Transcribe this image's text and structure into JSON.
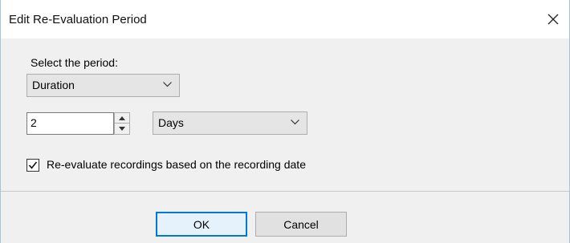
{
  "dialog": {
    "title": "Edit Re-Evaluation Period",
    "close_icon": "close-icon"
  },
  "form": {
    "period_label": "Select the period:",
    "period_value": "Duration",
    "amount_value": "2",
    "unit_value": "Days",
    "checkbox_checked": true,
    "checkbox_label": "Re-evaluate recordings based on the recording date"
  },
  "buttons": {
    "ok_label": "OK",
    "cancel_label": "Cancel"
  },
  "colors": {
    "focus_accent": "#0078d7",
    "dialog_background": "#f0f0f0"
  }
}
